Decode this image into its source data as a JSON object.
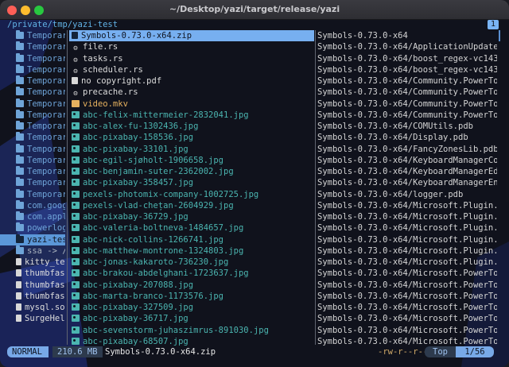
{
  "window": {
    "title": "~/Desktop/yazi/target/release/yazi"
  },
  "header": {
    "path": "/private/tmp/yazi-test",
    "tab": "1"
  },
  "parent_pane": [
    {
      "name": "Temporar",
      "kind": "dir"
    },
    {
      "name": "Temporar",
      "kind": "dir"
    },
    {
      "name": "Temporar",
      "kind": "dir"
    },
    {
      "name": "Temporar",
      "kind": "dir"
    },
    {
      "name": "Temporar",
      "kind": "dir"
    },
    {
      "name": "Temporar",
      "kind": "dir"
    },
    {
      "name": "Temporar",
      "kind": "dir"
    },
    {
      "name": "Temporar",
      "kind": "dir"
    },
    {
      "name": "Temporar",
      "kind": "dir"
    },
    {
      "name": "Temporar",
      "kind": "dir"
    },
    {
      "name": "Temporar",
      "kind": "dir"
    },
    {
      "name": "Temporar",
      "kind": "dir"
    },
    {
      "name": "Temporar",
      "kind": "dir"
    },
    {
      "name": "Temporar",
      "kind": "dir"
    },
    {
      "name": "Temporar",
      "kind": "dir"
    },
    {
      "name": "com.goog",
      "kind": "dir"
    },
    {
      "name": "com.appl",
      "kind": "dir"
    },
    {
      "name": "powerlog",
      "kind": "dir"
    },
    {
      "name": "yazi-tes",
      "kind": "dir",
      "selected": true
    },
    {
      "name": "ssa -> /",
      "kind": "link"
    },
    {
      "name": "kitty_te",
      "kind": "file"
    },
    {
      "name": "thumbfas",
      "kind": "file"
    },
    {
      "name": "thumbfas",
      "kind": "file"
    },
    {
      "name": "thumbfas",
      "kind": "file"
    },
    {
      "name": "mysql.so",
      "kind": "file"
    },
    {
      "name": "SurgeHel",
      "kind": "file"
    }
  ],
  "current_pane": [
    {
      "name": "Symbols-0.73.0-x64.zip",
      "kind": "zip",
      "selected": true
    },
    {
      "name": "file.rs",
      "kind": "config"
    },
    {
      "name": "tasks.rs",
      "kind": "config"
    },
    {
      "name": "scheduler.rs",
      "kind": "config"
    },
    {
      "name": "no copyright.pdf",
      "kind": "doc"
    },
    {
      "name": "precache.rs",
      "kind": "config"
    },
    {
      "name": "video.mkv",
      "kind": "video"
    },
    {
      "name": "abc-felix-mittermeier-2832041.jpg",
      "kind": "image"
    },
    {
      "name": "abc-alex-fu-1302436.jpg",
      "kind": "image"
    },
    {
      "name": "abc-pixabay-158536.jpg",
      "kind": "image"
    },
    {
      "name": "abc-pixabay-33101.jpg",
      "kind": "image"
    },
    {
      "name": "abc-egil-sjøholt-1906658.jpg",
      "kind": "image"
    },
    {
      "name": "abc-benjamin-suter-2362002.jpg",
      "kind": "image"
    },
    {
      "name": "abc-pixabay-358457.jpg",
      "kind": "image"
    },
    {
      "name": "pexels-photomix-company-1002725.jpg",
      "kind": "image"
    },
    {
      "name": "pexels-vlad-chețan-2604929.jpg",
      "kind": "image"
    },
    {
      "name": "abc-pixabay-36729.jpg",
      "kind": "image"
    },
    {
      "name": "abc-valeria-boltneva-1484657.jpg",
      "kind": "image"
    },
    {
      "name": "abc-nick-collins-1266741.jpg",
      "kind": "image"
    },
    {
      "name": "abc-matthew-montrone-1324803.jpg",
      "kind": "image"
    },
    {
      "name": "abc-jonas-kakaroto-736230.jpg",
      "kind": "image"
    },
    {
      "name": "abc-brakou-abdelghani-1723637.jpg",
      "kind": "image"
    },
    {
      "name": "abc-pixabay-207088.jpg",
      "kind": "image"
    },
    {
      "name": "abc-marta-branco-1173576.jpg",
      "kind": "image"
    },
    {
      "name": "abc-pixabay-327509.jpg",
      "kind": "image"
    },
    {
      "name": "abc-pixabay-36717.jpg",
      "kind": "image"
    },
    {
      "name": "abc-sevenstorm-juhaszimrus-891030.jpg",
      "kind": "image"
    },
    {
      "name": "abc-pixabay-68507.jpg",
      "kind": "image"
    }
  ],
  "preview_pane": [
    "Symbols-0.73.0-x64",
    "Symbols-0.73.0-x64/ApplicationUpdate.",
    "Symbols-0.73.0-x64/boost_regex-vc143-",
    "Symbols-0.73.0-x64/boost_regex-vc143-",
    "Symbols-0.73.0-x64/Community.PowerToy",
    "Symbols-0.73.0-x64/Community.PowerToy",
    "Symbols-0.73.0-x64/Community.PowerToy",
    "Symbols-0.73.0-x64/Community.PowerToy",
    "Symbols-0.73.0-x64/COMUtils.pdb",
    "Symbols-0.73.0-x64/Display.pdb",
    "Symbols-0.73.0-x64/FancyZonesLib.pdb",
    "Symbols-0.73.0-x64/KeyboardManagerCom",
    "Symbols-0.73.0-x64/KeyboardManagerEdi",
    "Symbols-0.73.0-x64/KeyboardManagerEng",
    "Symbols-0.73.0-x64/logger.pdb",
    "Symbols-0.73.0-x64/Microsoft.Plugin.F",
    "Symbols-0.73.0-x64/Microsoft.Plugin.I",
    "Symbols-0.73.0-x64/Microsoft.Plugin.P",
    "Symbols-0.73.0-x64/Microsoft.Plugin.S",
    "Symbols-0.73.0-x64/Microsoft.Plugin.U",
    "Symbols-0.73.0-x64/Microsoft.Plugin.W",
    "Symbols-0.73.0-x64/Microsoft.PowerToy",
    "Symbols-0.73.0-x64/Microsoft.PowerToy",
    "Symbols-0.73.0-x64/Microsoft.PowerToy",
    "Symbols-0.73.0-x64/Microsoft.PowerToy",
    "Symbols-0.73.0-x64/Microsoft.PowerToy",
    "Symbols-0.73.0-x64/Microsoft.PowerToy",
    "Symbols-0.73.0-x64/Microsoft.PowerToy"
  ],
  "status": {
    "mode": "NORMAL",
    "size": "210.6 MB",
    "filename": "Symbols-0.73.0-x64.zip",
    "permissions": "-rw-r--r--",
    "position": "Top",
    "count": "1/56"
  },
  "colors": {
    "accent": "#78a9e8",
    "directory": "#6ea4d8",
    "image": "#4bb5b0",
    "video": "#e7b25f",
    "path": "#62b3e6"
  }
}
